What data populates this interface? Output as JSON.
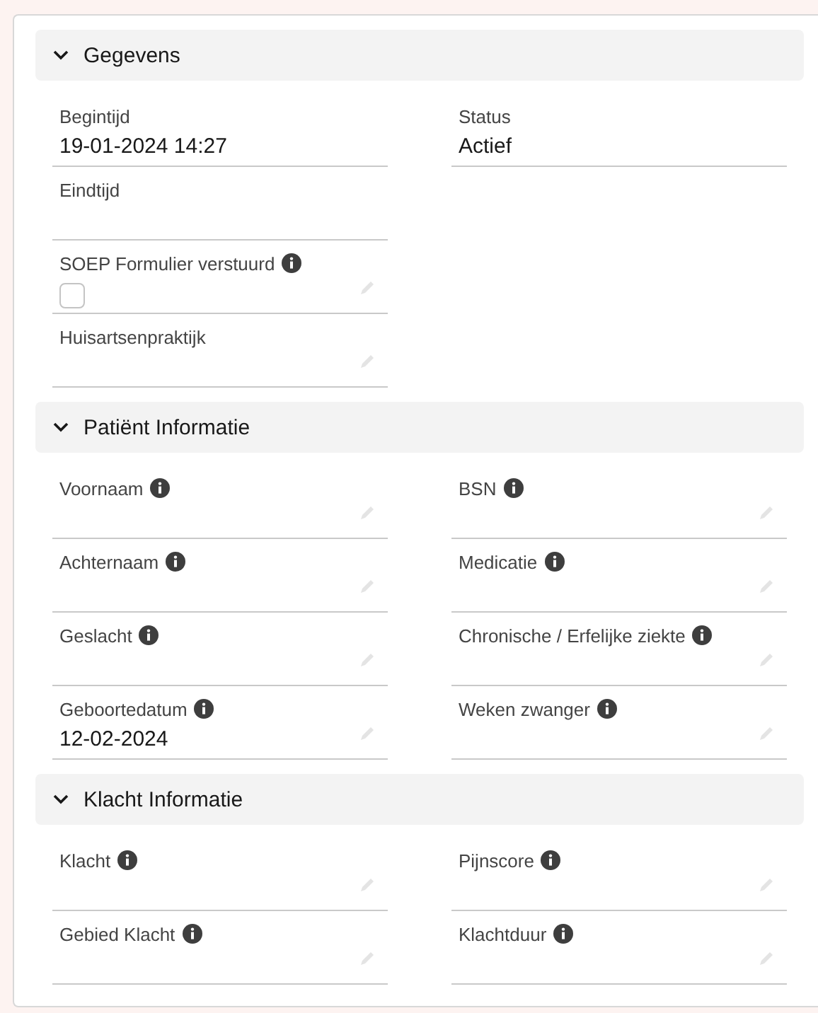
{
  "sections": [
    {
      "title": "Gegevens",
      "expanded": true,
      "rows": [
        [
          {
            "kind": "text",
            "label": "Begintijd",
            "info": false,
            "editable": false,
            "value": "19-01-2024 14:27"
          },
          {
            "kind": "text",
            "label": "Status",
            "info": false,
            "editable": false,
            "value": "Actief"
          }
        ],
        [
          {
            "kind": "text",
            "label": "Eindtijd",
            "info": false,
            "editable": false
          },
          null
        ],
        [
          {
            "kind": "checkbox",
            "label": "SOEP Formulier verstuurd",
            "info": true,
            "editable": true,
            "checked": false
          },
          null
        ],
        [
          {
            "kind": "text",
            "label": "Huisartsenpraktijk",
            "info": false,
            "editable": true
          },
          null
        ]
      ]
    },
    {
      "title": "Patiënt Informatie",
      "expanded": true,
      "rows": [
        [
          {
            "kind": "text",
            "label": "Voornaam",
            "info": true,
            "editable": true
          },
          {
            "kind": "text",
            "label": "BSN",
            "info": true,
            "editable": true
          }
        ],
        [
          {
            "kind": "text",
            "label": "Achternaam",
            "info": true,
            "editable": true
          },
          {
            "kind": "text",
            "label": "Medicatie",
            "info": true,
            "editable": true
          }
        ],
        [
          {
            "kind": "text",
            "label": "Geslacht",
            "info": true,
            "editable": true
          },
          {
            "kind": "text",
            "label": "Chronische / Erfelijke ziekte",
            "info": true,
            "editable": true
          }
        ],
        [
          {
            "kind": "text",
            "label": "Geboortedatum",
            "info": true,
            "editable": true,
            "value": "12-02-2024"
          },
          {
            "kind": "text",
            "label": "Weken zwanger",
            "info": true,
            "editable": true
          }
        ]
      ]
    },
    {
      "title": "Klacht Informatie",
      "expanded": true,
      "rows": [
        [
          {
            "kind": "text",
            "label": "Klacht",
            "info": true,
            "editable": true
          },
          {
            "kind": "text",
            "label": "Pijnscore",
            "info": true,
            "editable": true
          }
        ],
        [
          {
            "kind": "text",
            "label": "Gebied Klacht",
            "info": true,
            "editable": true
          },
          {
            "kind": "text",
            "label": "Klachtduur",
            "info": true,
            "editable": true
          }
        ]
      ]
    }
  ]
}
